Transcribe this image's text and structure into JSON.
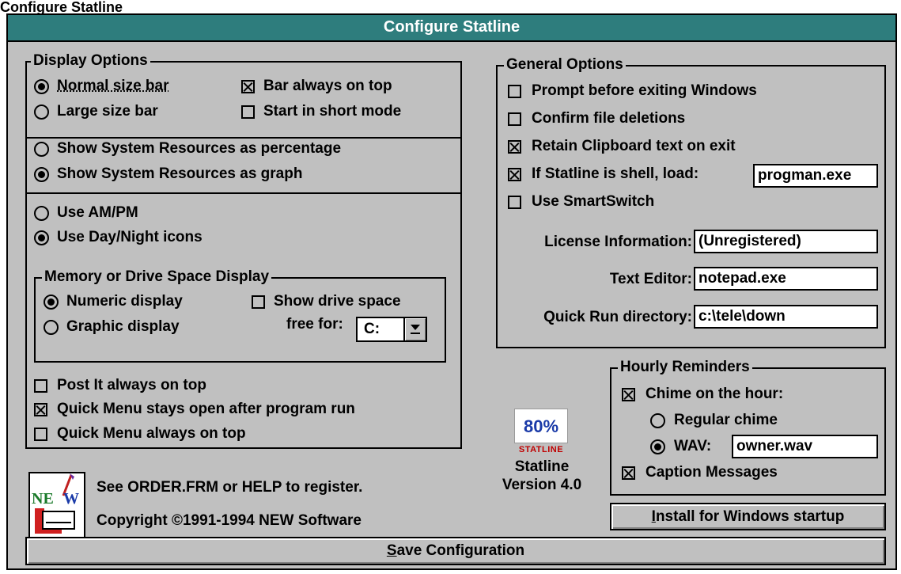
{
  "page_title": "Configure Statline",
  "window": {
    "title": "Configure Statline"
  },
  "display_options": {
    "legend": "Display Options",
    "normal_size": {
      "label": "Normal size bar",
      "checked": true
    },
    "large_size": {
      "label": "Large size bar",
      "checked": false
    },
    "always_on_top": {
      "label": "Bar always on top",
      "checked": true
    },
    "short_mode": {
      "label": "Start in short mode",
      "checked": false
    },
    "res_percentage": {
      "label": "Show System Resources as percentage",
      "checked": false
    },
    "res_graph": {
      "label": "Show System Resources as graph",
      "checked": true
    },
    "ampm": {
      "label": "Use AM/PM",
      "checked": false
    },
    "daynight": {
      "label": "Use Day/Night icons",
      "checked": true
    },
    "memory": {
      "legend": "Memory or Drive Space Display",
      "numeric": {
        "label": "Numeric display",
        "checked": true
      },
      "graphic": {
        "label": "Graphic display",
        "checked": false
      },
      "show_drive": {
        "label_line1": "Show drive space",
        "label_line2": "free for:",
        "checked": false
      },
      "drive_value": "C:"
    },
    "postit_top": {
      "label": "Post It always on top",
      "checked": false
    },
    "quickmenu_open": {
      "label": "Quick Menu stays open after program run",
      "checked": true
    },
    "quickmenu_top": {
      "label": "Quick Menu always on top",
      "checked": false
    }
  },
  "general_options": {
    "legend": "General Options",
    "prompt_exit": {
      "label": "Prompt before exiting Windows",
      "checked": false
    },
    "confirm_delete": {
      "label": "Confirm file deletions",
      "checked": false
    },
    "retain_clipboard": {
      "label": "Retain Clipboard text on exit",
      "checked": true
    },
    "shell_load": {
      "label": "If Statline is shell, load:",
      "checked": true,
      "value": "progman.exe"
    },
    "smartswitch": {
      "label": "Use SmartSwitch",
      "checked": false
    },
    "license": {
      "label": "License Information:",
      "value": "(Unregistered)"
    },
    "editor": {
      "label": "Text Editor:",
      "value": "notepad.exe"
    },
    "quickrun": {
      "label": "Quick Run directory:",
      "value": "c:\\tele\\down"
    }
  },
  "hourly": {
    "legend": "Hourly Reminders",
    "chime": {
      "label": "Chime on the hour:",
      "checked": true
    },
    "regular": {
      "label": "Regular chime",
      "checked": false
    },
    "wav": {
      "label": "WAV:",
      "checked": true,
      "value": "owner.wav"
    },
    "caption": {
      "label": "Caption Messages",
      "checked": true
    }
  },
  "logo": {
    "percent": "80%",
    "brand": "STATLINE",
    "name": "Statline",
    "version": "Version 4.0"
  },
  "footer": {
    "register": "See ORDER.FRM or HELP to register.",
    "copyright": "Copyright ©1991-1994 NEW Software"
  },
  "buttons": {
    "install": {
      "mnemonic": "I",
      "rest": "nstall for Windows startup"
    },
    "save": {
      "mnemonic": "S",
      "rest": "ave Configuration"
    }
  }
}
